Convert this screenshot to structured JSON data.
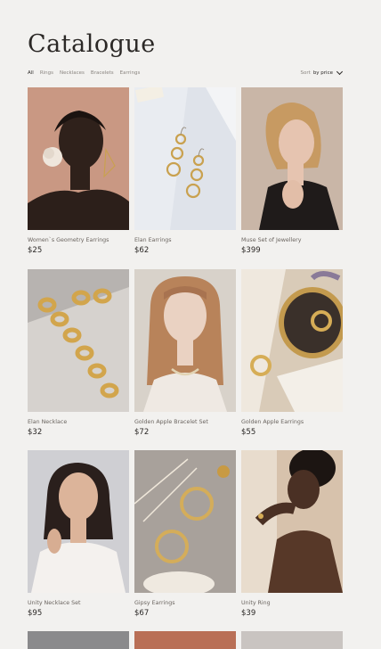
{
  "page": {
    "title": "Catalogue"
  },
  "filters": [
    {
      "label": "All",
      "active": true
    },
    {
      "label": "Rings",
      "active": false
    },
    {
      "label": "Necklaces",
      "active": false
    },
    {
      "label": "Bracelets",
      "active": false
    },
    {
      "label": "Earrings",
      "active": false
    }
  ],
  "sort": {
    "prefix": "Sort",
    "value": "by price"
  },
  "products": [
    {
      "name": "Women`s Geometry Earrings",
      "price": "$25"
    },
    {
      "name": "Elan Earrings",
      "price": "$62"
    },
    {
      "name": "Muse Set of Jewellery",
      "price": "$399"
    },
    {
      "name": "Elan Necklace",
      "price": "$32"
    },
    {
      "name": "Golden Apple Bracelet Set",
      "price": "$72"
    },
    {
      "name": "Golden Apple Earrings",
      "price": "$55"
    },
    {
      "name": "Unity Necklace Set",
      "price": "$95"
    },
    {
      "name": "Gipsy Earrings",
      "price": "$67"
    },
    {
      "name": "Unity Ring",
      "price": "$39"
    }
  ],
  "colors": {
    "background": "#f2f1ef",
    "text": "#2b2826",
    "muted": "#8a8580"
  }
}
